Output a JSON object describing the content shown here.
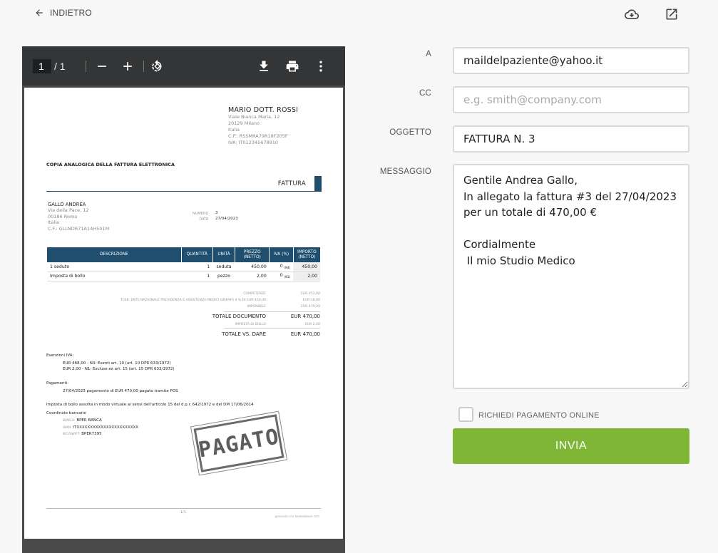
{
  "header": {
    "back_label": "INDIETRO",
    "download_icon": "cloud-download-icon",
    "open_external_icon": "open-in-new-icon"
  },
  "viewer": {
    "current_page": "1",
    "total_pages": "/ 1",
    "zoom_out_icon": "minus-icon",
    "zoom_in_icon": "plus-icon",
    "rotate_icon": "rotate-icon",
    "download_icon": "download-icon",
    "print_icon": "print-icon",
    "more_icon": "more-vertical-icon"
  },
  "invoice": {
    "issuer": {
      "name": "MARIO DOTT. ROSSI",
      "address1": "Viale Bianca Maria, 12",
      "address2": "20129 Milano",
      "country": "Italia",
      "cf": "C.F.: RSSMRA79R18F205F",
      "iva": "IVA: IT012345678910"
    },
    "copy_title": "COPIA ANALOGICA DELLA FATTURA ELETTRONICA",
    "doc_type": "FATTURA",
    "client": {
      "name": "GALLO ANDREA",
      "address1": "Via della Pace, 12",
      "address2": "00186 Roma",
      "country": "Italia",
      "cf": "C.F.: GLLNDR71A14H501M"
    },
    "number_label": "NUMERO",
    "number": "3",
    "date_label": "DATA",
    "date": "27/04/2023",
    "table_headers": [
      "DESCRIZIONE",
      "QUANTITÀ",
      "UNITÀ",
      "PREZZO (NETTO)",
      "IVA (%)",
      "IMPORTO (NETTO)"
    ],
    "rows": [
      {
        "descr": "1 sedute",
        "qty": "1",
        "unit": "seduta",
        "price": "450,00",
        "iva": "0",
        "iva_code": "(N4)",
        "amount": "450,00"
      },
      {
        "descr": "Imposta di bollo",
        "qty": "1",
        "unit": "pezzo",
        "price": "2,00",
        "iva": "0",
        "iva_code": "(N1)",
        "amount": "2,00"
      }
    ],
    "summary": {
      "competenze_label": "COMPETENZE",
      "competenze": "EUR 452,00",
      "enpam_label": "TC08: ENTE NAZIONALE PREVIDENZA E ASSISTENZA MEDICI (ENPAM) 4 % DI EUR 450,00",
      "enpam": "EUR 18,00",
      "imponibile_label": "IMPONIBILE",
      "imponibile": "EUR 470,00",
      "totale_doc_label": "TOTALE DOCUMENTO",
      "totale_doc": "EUR 470,00",
      "bollo_label": "IMPOSTA DI BOLLO",
      "bollo": "EUR 2,00",
      "totale_dare_label": "TOTALE VS. DARE",
      "totale_dare": "EUR 470,00"
    },
    "esenzioni_title": "Esenzioni IVA:",
    "esenzioni": [
      "EUR 468,00 - N4: Esenti art. 10 (art. 10 DPR 633/1972)",
      "EUR 2,00 - N1: Escluse ex art. 15 (art. 15 DPR 633/1972)"
    ],
    "pagamenti_title": "Pagamenti:",
    "pagamenti": "27/04/2023 pagamento di EUR 470,00 pagato tramite POS",
    "bollo_note": "Imposta di bollo assolta in modo virtuale ai sensi dell'articolo 15 del d.p.r. 642/1972 e del DM 17/06/2014",
    "coordinate_title": "Coordinate bancarie",
    "bank": {
      "banca_label": "BANCA:",
      "banca": "BPER BANCA",
      "iban_label": "IBAN:",
      "iban": "ITXXXXXXXXXXXXXXXXXXXXXXX",
      "bic_label": "BIC/SWIFT:",
      "bic": "BPER7395"
    },
    "stamp": "PAGATO",
    "page_footer": "1/1",
    "generated": "generato con beebeebook.com"
  },
  "form": {
    "to_label": "A",
    "to_value": "maildelpaziente@yahoo.it",
    "cc_label": "CC",
    "cc_placeholder": "e.g. smith@company.com",
    "subject_label": "OGGETTO",
    "subject_value": "FATTURA N. 3",
    "message_label": "MESSAGGIO",
    "message_value": "Gentile Andrea Gallo,\nIn allegato la fattura #3 del 27/04/2023 per un totale di 470,00 €\n\nCordialmente\n Il mio Studio Medico",
    "online_payment_label": "RICHIEDI PAGAMENTO ONLINE",
    "send_label": "INVIA"
  },
  "colors": {
    "accent_green": "#80b636",
    "invoice_blue": "#1f4e6e",
    "viewer_toolbar": "#333537"
  }
}
